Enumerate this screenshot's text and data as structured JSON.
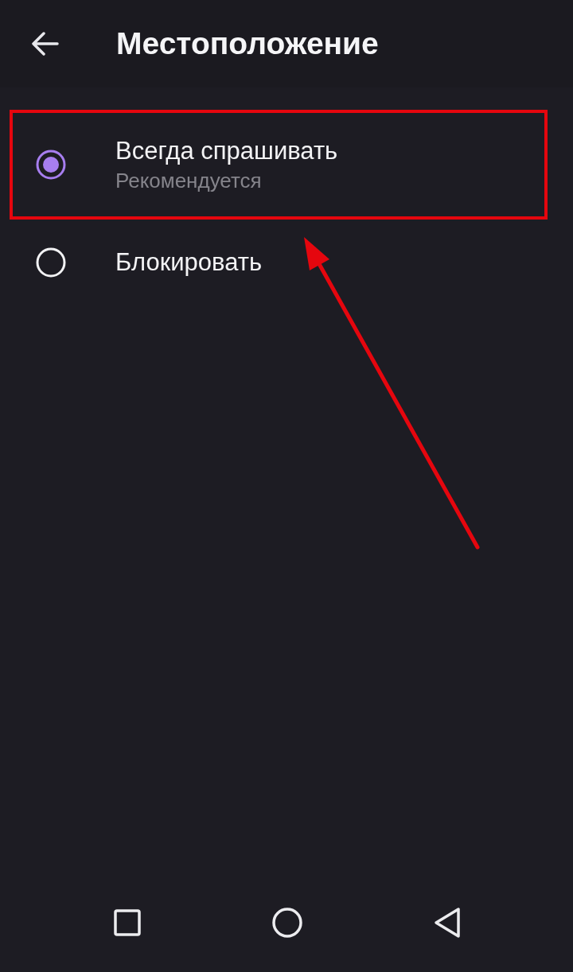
{
  "header": {
    "title": "Местоположение"
  },
  "options": [
    {
      "label": "Всегда спрашивать",
      "summary": "Рекомендуется",
      "selected": true,
      "highlighted": true
    },
    {
      "label": "Блокировать",
      "selected": false,
      "highlighted": false
    }
  ],
  "annotations": [
    {
      "kind": "arrow"
    }
  ]
}
